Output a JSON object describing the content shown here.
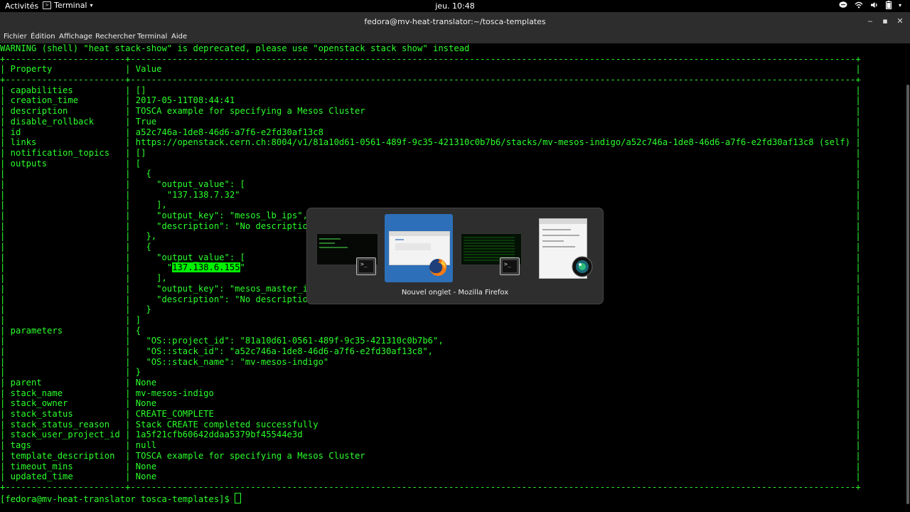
{
  "topbar": {
    "activities": "Activités",
    "app_label": "Terminal",
    "clock": "jeu. 10:48"
  },
  "window": {
    "title": "fedora@mv-heat-translator:~/tosca-templates"
  },
  "menu": [
    "Fichier",
    "Édition",
    "Affichage",
    "Rechercher",
    "Terminal",
    "Aide"
  ],
  "terminal": {
    "warning": "WARNING (shell) \"heat stack-show\" is deprecated, please use \"openstack stack show\" instead",
    "header": {
      "property": "Property",
      "value": "Value"
    },
    "rows": [
      [
        "capabilities",
        "[]"
      ],
      [
        "creation_time",
        "2017-05-11T08:44:41"
      ],
      [
        "description",
        "TOSCA example for specifying a Mesos Cluster"
      ],
      [
        "disable_rollback",
        "True"
      ],
      [
        "id",
        "a52c746a-1de8-46d6-a7f6-e2fd30af13c8"
      ],
      [
        "links",
        "https://openstack.cern.ch:8004/v1/81a10d61-0561-489f-9c35-421310c0b7b6/stacks/mv-mesos-indigo/a52c746a-1de8-46d6-a7f6-e2fd30af13c8 (self)"
      ],
      [
        "notification_topics",
        "[]"
      ],
      [
        "outputs",
        "["
      ],
      [
        "",
        "  {"
      ],
      [
        "",
        "    \"output_value\": ["
      ],
      [
        "",
        "      \"137.138.7.32\""
      ],
      [
        "",
        "    ],"
      ],
      [
        "",
        "    \"output_key\": \"mesos_lb_ips\","
      ],
      [
        "",
        "    \"description\": \"No description given\""
      ],
      [
        "",
        "  },"
      ],
      [
        "",
        "  {"
      ],
      [
        "",
        "    \"output_value\": ["
      ],
      [
        "",
        "      \"137.138.6.155\""
      ],
      [
        "",
        "    ],"
      ],
      [
        "",
        "    \"output_key\": \"mesos_master_ips\","
      ],
      [
        "",
        "    \"description\": \"No description given\""
      ],
      [
        "",
        "  }"
      ],
      [
        "",
        "]"
      ],
      [
        "parameters",
        "{"
      ],
      [
        "",
        "  \"OS::project_id\": \"81a10d61-0561-489f-9c35-421310c0b7b6\","
      ],
      [
        "",
        "  \"OS::stack_id\": \"a52c746a-1de8-46d6-a7f6-e2fd30af13c8\","
      ],
      [
        "",
        "  \"OS::stack_name\": \"mv-mesos-indigo\""
      ],
      [
        "",
        "}"
      ],
      [
        "parent",
        "None"
      ],
      [
        "stack_name",
        "mv-mesos-indigo"
      ],
      [
        "stack_owner",
        "None"
      ],
      [
        "stack_status",
        "CREATE_COMPLETE"
      ],
      [
        "stack_status_reason",
        "Stack CREATE completed successfully"
      ],
      [
        "stack_user_project_id",
        "1a5f21cfb60642ddaa5379bf45544e3d"
      ],
      [
        "tags",
        "null"
      ],
      [
        "template_description",
        "TOSCA example for specifying a Mesos Cluster"
      ],
      [
        "timeout_mins",
        "None"
      ],
      [
        "updated_time",
        "None"
      ]
    ],
    "highlight_text": "137.138.6.155",
    "prompt": "[fedora@mv-heat-translator tosca-templates]$ "
  },
  "switcher": {
    "label": "Nouvel onglet - Mozilla Firefox",
    "windows": [
      {
        "app": "terminal",
        "icon": "terminal-icon"
      },
      {
        "app": "firefox",
        "icon": "firefox-icon",
        "selected": true
      },
      {
        "app": "terminal",
        "icon": "terminal-icon"
      },
      {
        "app": "image-viewer",
        "icon": "camera-lens-icon"
      }
    ]
  },
  "colors": {
    "terminal_text": "#2bff2b",
    "selection": "#2d6fb8",
    "highlight": "#00f000"
  }
}
